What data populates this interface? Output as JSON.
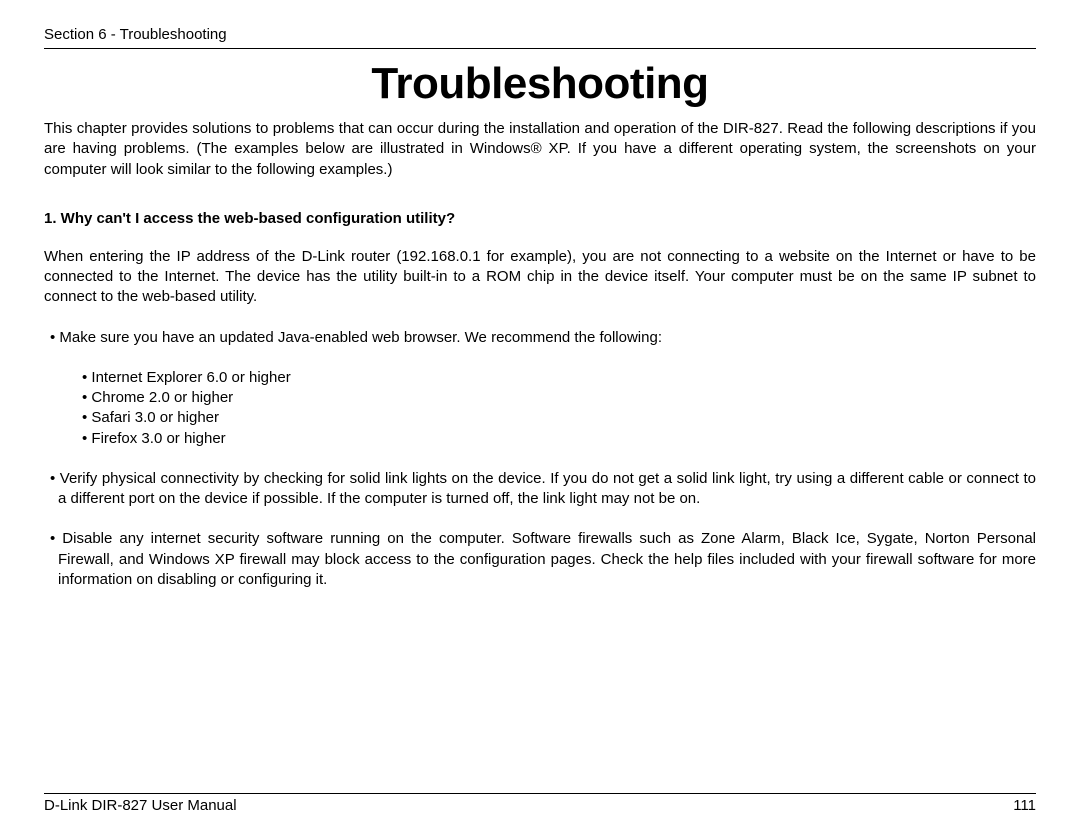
{
  "header": {
    "section_label": "Section 6 - Troubleshooting"
  },
  "title": "Troubleshooting",
  "intro": "This chapter provides solutions to problems that can occur during the installation and operation of the DIR-827. Read the following descriptions if you are having problems. (The examples below are illustrated in Windows® XP. If you have a different operating system, the screenshots on your computer will look similar to the following examples.)",
  "question": "1. Why can't I access the web-based configuration utility?",
  "answer_intro": "When entering the IP address of the D-Link router (192.168.0.1 for example), you are not connecting to a website on the Internet or have to be connected to the Internet. The device has the utility built-in to a ROM chip in the device itself. Your computer must be on the same IP subnet to connect to the web-based utility.",
  "bullets": {
    "b1": "•  Make sure you have an updated Java-enabled web browser. We recommend the following:",
    "sub": {
      "s1": "• Internet Explorer 6.0 or higher",
      "s2": "• Chrome 2.0 or higher",
      "s3": "• Safari 3.0 or higher",
      "s4": "• Firefox 3.0 or higher"
    },
    "b2": "•  Verify physical connectivity by checking for solid link lights on the device. If you do not get a solid link light, try using a different cable or connect to a different port on the device if possible. If the computer is turned off, the link light may not be on.",
    "b3": "•  Disable any internet security software running on the computer. Software firewalls such as Zone Alarm, Black Ice, Sygate, Norton Personal Firewall, and Windows XP firewall may block access to the configuration pages. Check the help files included with your firewall software for more information on disabling or configuring it."
  },
  "footer": {
    "manual_label": "D-Link DIR-827 User Manual",
    "page_number": "111"
  }
}
